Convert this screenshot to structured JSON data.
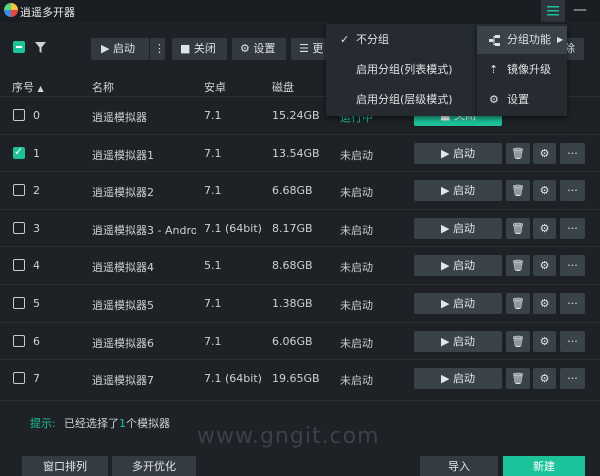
{
  "window": {
    "title": "逍遥多开器",
    "menu_icon": "hamburger-icon",
    "minimize_glyph": "—"
  },
  "toolbar": {
    "start_label": "启动",
    "more_glyph": "⋮",
    "close_label": "关闭",
    "settings_label": "设置",
    "more_label": "更",
    "delete_label": "除"
  },
  "table": {
    "headers": {
      "index": "序号",
      "name": "名称",
      "android": "安卓",
      "disk": "磁盘"
    },
    "start_label": "启动",
    "running_button_label": "关闭",
    "more_glyph": "···",
    "rows": [
      {
        "index": "0",
        "name": "逍遥模拟器",
        "android": "7.1",
        "disk": "15.24GB",
        "status": "运行中",
        "checked": false,
        "running": true
      },
      {
        "index": "1",
        "name": "逍遥模拟器1",
        "android": "7.1",
        "disk": "13.54GB",
        "status": "未启动",
        "checked": true,
        "running": false
      },
      {
        "index": "2",
        "name": "逍遥模拟器2",
        "android": "7.1",
        "disk": "6.68GB",
        "status": "未启动",
        "checked": false,
        "running": false
      },
      {
        "index": "3",
        "name": "逍遥模拟器3 - Andro",
        "android": "7.1 (64bit)",
        "disk": "8.17GB",
        "status": "未启动",
        "checked": false,
        "running": false
      },
      {
        "index": "4",
        "name": "逍遥模拟器4",
        "android": "5.1",
        "disk": "8.68GB",
        "status": "未启动",
        "checked": false,
        "running": false
      },
      {
        "index": "5",
        "name": "逍遥模拟器5",
        "android": "7.1",
        "disk": "1.38GB",
        "status": "未启动",
        "checked": false,
        "running": false
      },
      {
        "index": "6",
        "name": "逍遥模拟器6",
        "android": "7.1",
        "disk": "6.06GB",
        "status": "未启动",
        "checked": false,
        "running": false
      },
      {
        "index": "7",
        "name": "逍遥模拟器7",
        "android": "7.1 (64bit)",
        "disk": "19.65GB",
        "status": "未启动",
        "checked": false,
        "running": false
      }
    ]
  },
  "hint": {
    "prefix": "提示:",
    "text_before": "已经选择了",
    "count": "1",
    "text_after": "个模拟器"
  },
  "watermark": "www.gngit.com",
  "bottom": {
    "arrange_label": "窗口排列",
    "optimize_label": "多开优化",
    "import_label": "导入",
    "new_label": "新建"
  },
  "group_menu": {
    "items": [
      {
        "label": "不分组",
        "checked": true
      },
      {
        "label": "启用分组(列表模式)",
        "checked": false
      },
      {
        "label": "启用分组(层级模式)",
        "checked": false
      }
    ]
  },
  "main_menu": {
    "items": [
      {
        "label": "分组功能",
        "icon": "group-icon",
        "has_submenu": true
      },
      {
        "label": "镜像升级",
        "icon": "upgrade-icon",
        "has_submenu": false
      },
      {
        "label": "设置",
        "icon": "gear-icon",
        "has_submenu": false
      }
    ]
  },
  "colors": {
    "accent": "#1cc39a",
    "background": "#1e2226",
    "button": "#3a424a"
  }
}
